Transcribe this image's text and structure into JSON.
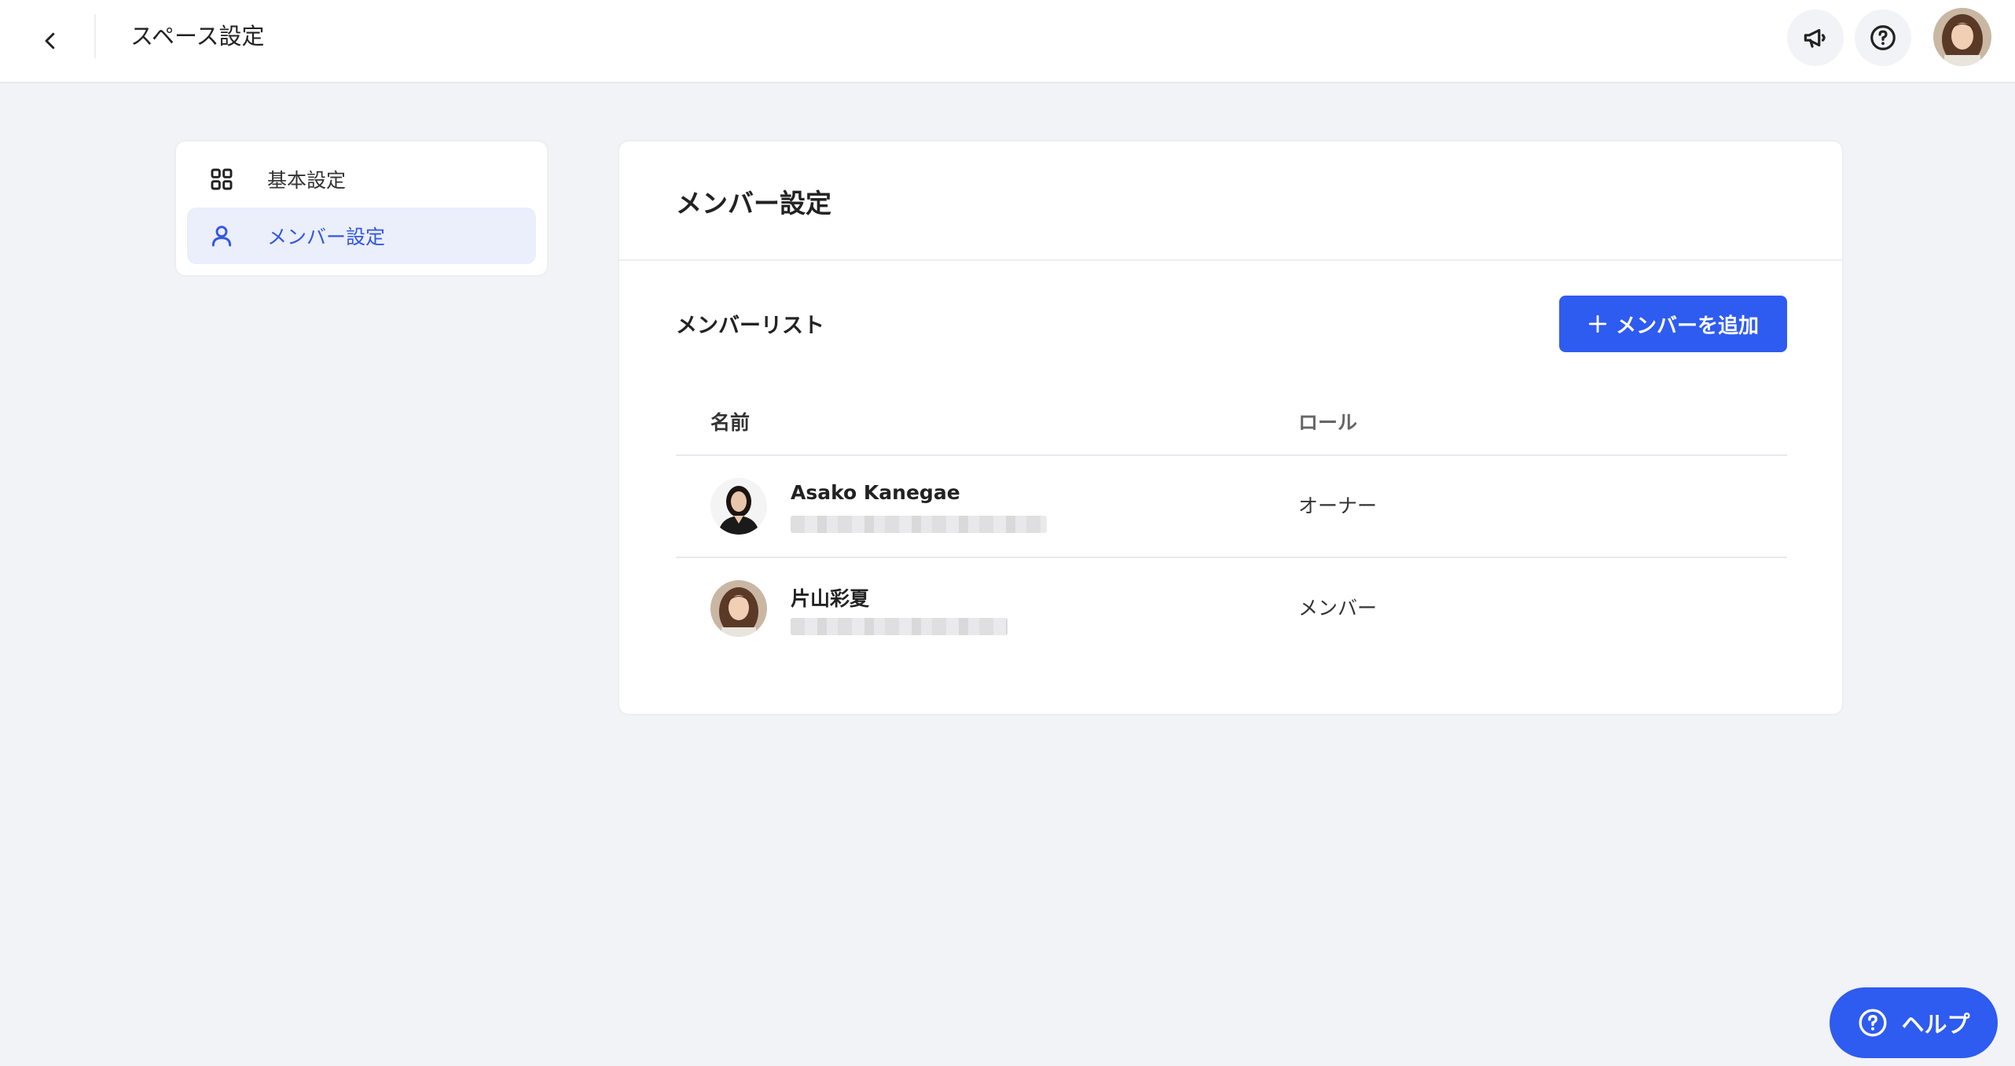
{
  "header": {
    "title": "スペース設定",
    "back_icon": "chevron-left-icon",
    "announce_icon": "megaphone-icon",
    "help_icon": "question-circle-icon"
  },
  "sidebar": {
    "items": [
      {
        "label": "基本設定",
        "icon": "grid-icon",
        "active": false
      },
      {
        "label": "メンバー設定",
        "icon": "user-icon",
        "active": true
      }
    ]
  },
  "main": {
    "title": "メンバー設定",
    "list_title": "メンバーリスト",
    "add_button_label": "メンバーを追加",
    "columns": {
      "name": "名前",
      "role": "ロール"
    },
    "members": [
      {
        "name": "Asako Kanegae",
        "role": "オーナー"
      },
      {
        "name": "片山彩夏",
        "role": "メンバー"
      }
    ]
  },
  "help_button": {
    "label": "ヘルプ"
  },
  "colors": {
    "accent": "#2e5bf0",
    "active_bg": "#ebeefb",
    "background": "#f2f3f6"
  }
}
